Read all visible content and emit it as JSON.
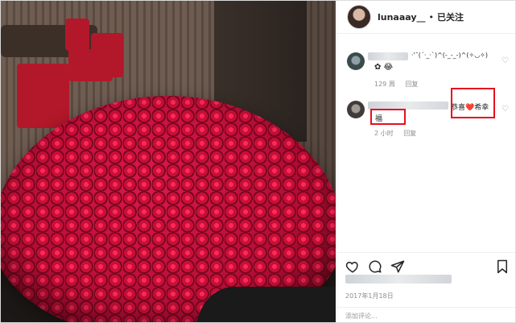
{
  "post": {
    "username": "lunaaay__",
    "separator": "•",
    "follow_label": "已关注"
  },
  "comments": [
    {
      "text": "·'˘(´·_·`)^(-_-_-)^(✧◡✧)",
      "emoji_line": "✿ 😂",
      "time": "129 周",
      "reply_label": "回复"
    },
    {
      "text_suffix": "恭喜❤️希幸",
      "text_cont": "福",
      "time": "2 小时",
      "reply_label": "回复"
    }
  ],
  "post_date": "2017年1月18日",
  "add_comment_placeholder": "添加评论...",
  "icons": {
    "like": "heart-icon",
    "comment": "comment-icon",
    "share": "share-icon",
    "save": "bookmark-icon",
    "comment_like": "small-heart-icon"
  },
  "colors": {
    "highlight_box": "#e5101e",
    "meta_text": "#8e8e8e"
  }
}
